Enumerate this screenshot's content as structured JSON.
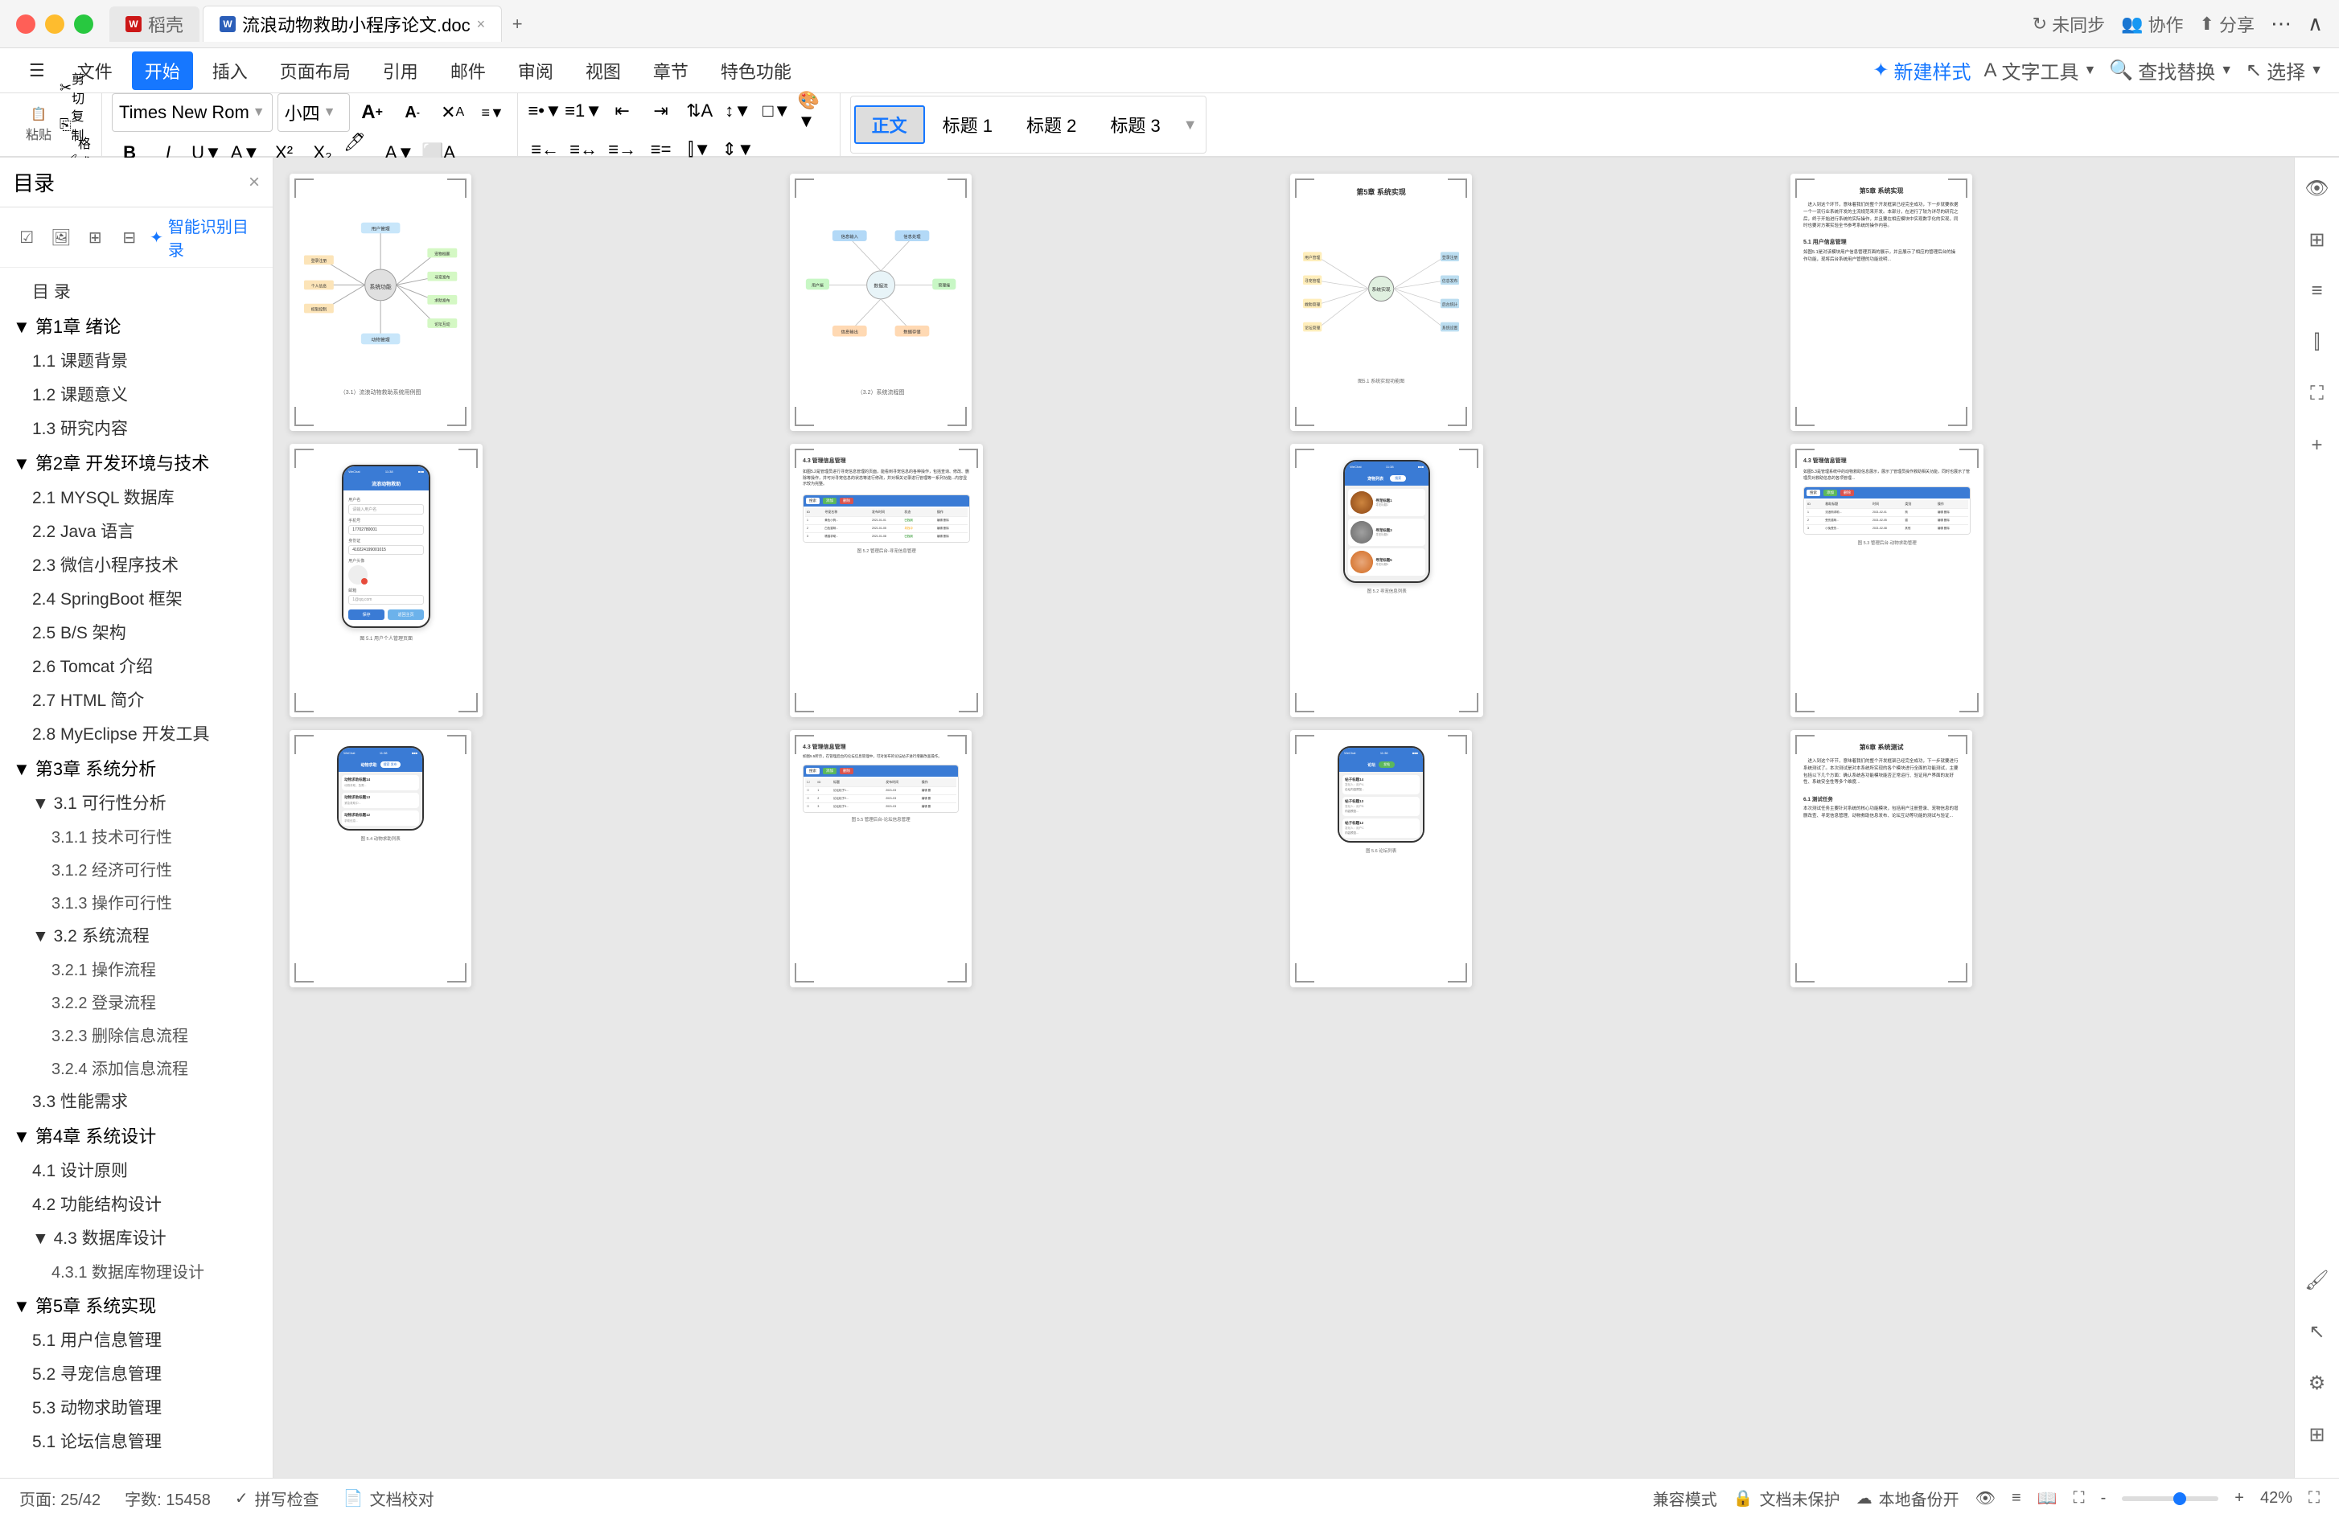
{
  "titlebar": {
    "app_name": "WPS",
    "tabs": [
      {
        "id": "tab-wps",
        "label": "稻壳",
        "type": "wps",
        "active": false,
        "closable": false
      },
      {
        "id": "tab-doc",
        "label": "流浪动物救助小程序论文.doc",
        "type": "word",
        "active": true,
        "closable": true
      }
    ],
    "new_tab_label": "+",
    "right_controls": {
      "sync": "未同步",
      "collab": "协作",
      "share": "分享"
    }
  },
  "menubar": {
    "items": [
      "文件",
      "开始",
      "插入",
      "页面布局",
      "引用",
      "邮件",
      "审阅",
      "视图",
      "章节",
      "特色功能"
    ],
    "active_item": "开始"
  },
  "toolbar": {
    "clipboard": {
      "paste_label": "粘贴",
      "cut_label": "剪切",
      "copy_label": "复制",
      "format_paint_label": "格式刷"
    },
    "font": {
      "name": "Times New Rom",
      "size": "小四",
      "increase_label": "A",
      "decrease_label": "A"
    },
    "styles": {
      "normal": "正文",
      "heading1": "标题 1",
      "heading2": "标题 2",
      "heading3": "标题 3",
      "new_style": "新建样式"
    },
    "tools": {
      "text_tools": "文字工具",
      "find_replace": "查找替换",
      "select": "选择"
    }
  },
  "sidebar": {
    "title": "目录",
    "ai_btn": "智能识别目录",
    "close_btn": "×",
    "toc": [
      {
        "level": 1,
        "text": "目  录",
        "collapsed": false
      },
      {
        "level": 1,
        "text": "第1章 绪论",
        "collapsed": false
      },
      {
        "level": 2,
        "text": "1.1 课题背景"
      },
      {
        "level": 2,
        "text": "1.2 课题意义"
      },
      {
        "level": 2,
        "text": "1.3 研究内容"
      },
      {
        "level": 1,
        "text": "第2章 开发环境与技术",
        "collapsed": false
      },
      {
        "level": 2,
        "text": "2.1 MYSQL 数据库"
      },
      {
        "level": 2,
        "text": "2.2 Java 语言"
      },
      {
        "level": 2,
        "text": "2.3 微信小程序技术"
      },
      {
        "level": 2,
        "text": "2.4 SpringBoot 框架"
      },
      {
        "level": 2,
        "text": "2.5 B/S 架构"
      },
      {
        "level": 2,
        "text": "2.6 Tomcat 介绍"
      },
      {
        "level": 2,
        "text": "2.7 HTML 简介"
      },
      {
        "level": 2,
        "text": "2.8 MyEclipse 开发工具"
      },
      {
        "level": 1,
        "text": "第3章 系统分析",
        "collapsed": false
      },
      {
        "level": 2,
        "text": "3.1 可行性分析",
        "collapsed": false
      },
      {
        "level": 3,
        "text": "3.1.1 技术可行性"
      },
      {
        "level": 3,
        "text": "3.1.2 经济可行性"
      },
      {
        "level": 3,
        "text": "3.1.3 操作可行性"
      },
      {
        "level": 2,
        "text": "3.2 系统流程",
        "collapsed": false
      },
      {
        "level": 3,
        "text": "3.2.1 操作流程"
      },
      {
        "level": 3,
        "text": "3.2.2 登录流程"
      },
      {
        "level": 3,
        "text": "3.2.3 删除信息流程"
      },
      {
        "level": 3,
        "text": "3.2.4 添加信息流程"
      },
      {
        "level": 2,
        "text": "3.3 性能需求"
      },
      {
        "level": 1,
        "text": "第4章 系统设计",
        "collapsed": false
      },
      {
        "level": 2,
        "text": "4.1 设计原则"
      },
      {
        "level": 2,
        "text": "4.2 功能结构设计"
      },
      {
        "level": 2,
        "text": "4.3 数据库设计",
        "collapsed": false
      },
      {
        "level": 3,
        "text": "4.3.1 数据库物理设计"
      },
      {
        "level": 1,
        "text": "第5章 系统实现",
        "collapsed": false
      },
      {
        "level": 2,
        "text": "5.1 用户信息管理"
      },
      {
        "level": 2,
        "text": "5.2  寻宠信息管理"
      },
      {
        "level": 2,
        "text": "5.3 动物求助管理"
      },
      {
        "level": 2,
        "text": "5.1 论坛信息管理"
      }
    ]
  },
  "document": {
    "pages": [
      {
        "id": "page1",
        "type": "mindmap",
        "description": "思维导图1"
      },
      {
        "id": "page2",
        "type": "mindmap",
        "description": "思维导图2"
      },
      {
        "id": "page3",
        "type": "mindmap_chapter5",
        "description": "第5章 系统实现 思维导图"
      },
      {
        "id": "page4",
        "type": "text_chapter5",
        "description": "第5章 系统实现 文字"
      },
      {
        "id": "page5",
        "type": "ui_login",
        "description": "登录界面截图"
      },
      {
        "id": "page6",
        "type": "ui_admin",
        "description": "管理后台截图"
      },
      {
        "id": "page7",
        "type": "ui_miniapp",
        "description": "小程序截图"
      },
      {
        "id": "page8",
        "type": "ui_admin2",
        "description": "管理后台截图2"
      },
      {
        "id": "page9",
        "type": "ui_miniapp2",
        "description": "小程序截图2"
      },
      {
        "id": "page10",
        "type": "ui_admin3",
        "description": "管理后台截图3"
      },
      {
        "id": "page11",
        "type": "ui_miniapp3",
        "description": "小程序截图3"
      },
      {
        "id": "page12",
        "type": "text_chapter6",
        "description": "第6章 系统测试"
      }
    ]
  },
  "statusbar": {
    "page_info": "页面: 25/42",
    "word_count": "字数: 15458",
    "spell_check": "拼写检查",
    "doc_review": "文档校对",
    "compat_mode": "兼容模式",
    "protect": "文档未保护",
    "backup": "本地备份开",
    "zoom": "42%"
  },
  "right_toolbar": {
    "tools": [
      "eye",
      "table",
      "list",
      "columns",
      "enlarge",
      "add"
    ]
  }
}
